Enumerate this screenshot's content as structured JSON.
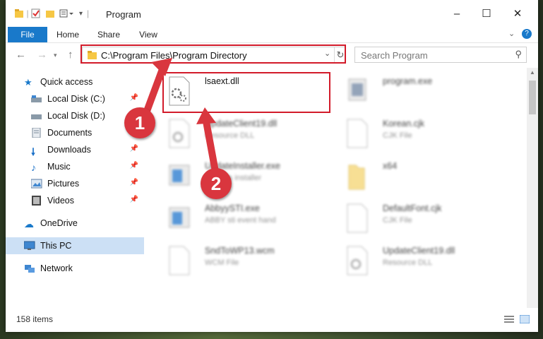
{
  "window": {
    "title": "Program"
  },
  "ribbon": {
    "tabs": [
      "File",
      "Home",
      "Share",
      "View"
    ]
  },
  "address": {
    "path": "C:\\Program Files\\Program Directory"
  },
  "search": {
    "placeholder": "Search Program"
  },
  "sidebar": {
    "quick_access": "Quick access",
    "items": [
      {
        "label": "Local Disk (C:)",
        "pinned": true
      },
      {
        "label": "Local Disk (D:)",
        "pinned": false
      },
      {
        "label": "Documents",
        "pinned": true
      },
      {
        "label": "Downloads",
        "pinned": true
      },
      {
        "label": "Music",
        "pinned": true
      },
      {
        "label": "Pictures",
        "pinned": true
      },
      {
        "label": "Videos",
        "pinned": true
      }
    ],
    "onedrive": "OneDrive",
    "this_pc": "This PC",
    "network": "Network"
  },
  "files": [
    {
      "name": "lsaext.dll",
      "type": ""
    },
    {
      "name": "program.exe",
      "type": ""
    },
    {
      "name": "UpdateClient19.dll",
      "type": "Resource DLL"
    },
    {
      "name": "Korean.cjk",
      "type": "CJK File"
    },
    {
      "name": "UpdateInstaller.exe",
      "type": "updates installer"
    },
    {
      "name": "x64",
      "type": ""
    },
    {
      "name": "AbbyySTI.exe",
      "type": "ABBY sti event hand"
    },
    {
      "name": "DefaultFont.cjk",
      "type": "CJK File"
    },
    {
      "name": "SndToWP13.wcm",
      "type": "WCM File"
    },
    {
      "name": "UpdateClient19.dll",
      "type": "Resource DLL"
    }
  ],
  "status": {
    "count": "158 items"
  },
  "callouts": [
    "1",
    "2"
  ],
  "colors": {
    "accent": "#1979ca",
    "highlight": "#d21b2a",
    "callout": "#d9363e",
    "selected": "#cce0f5"
  }
}
